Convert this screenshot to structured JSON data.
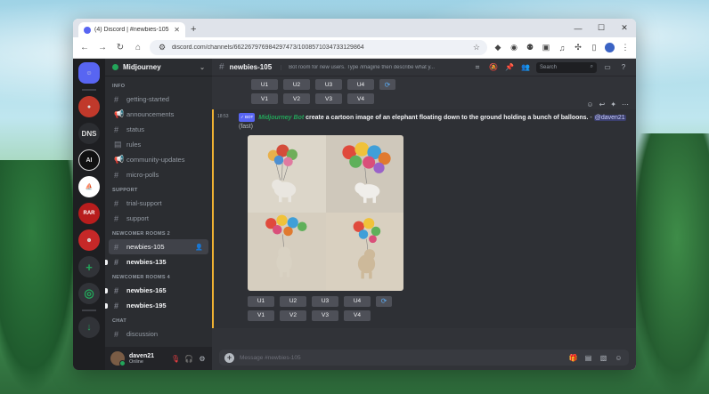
{
  "browser": {
    "tab_title": "(4) Discord | #newbies-105 | M",
    "url": "discord.com/channels/662267976984297473/1008571034733129864"
  },
  "guild": {
    "name": "Midjourney"
  },
  "servers": {
    "dns_label": "DNS",
    "ai_label": "AI",
    "rar_label": "RAR"
  },
  "channels": {
    "categories": {
      "info": "INFO",
      "support": "SUPPORT",
      "newcomer2": "NEWCOMER ROOMS 2",
      "newcomer4": "NEWCOMER ROOMS 4",
      "chat": "CHAT"
    },
    "items": {
      "getting_started": "getting-started",
      "announcements": "announcements",
      "status": "status",
      "rules": "rules",
      "community_updates": "community-updates",
      "micro_polls": "micro-polls",
      "trial_support": "trial-support",
      "support": "support",
      "newbies_105": "newbies-105",
      "newbies_135": "newbies-135",
      "newbies_165": "newbies-165",
      "newbies_195": "newbies-195",
      "discussion": "discussion"
    }
  },
  "user": {
    "name": "daven21",
    "status": "Online"
  },
  "header": {
    "channel": "newbies-105",
    "topic": "Bot room for new users. Type /imagine then describe what y...",
    "search_placeholder": "Search"
  },
  "buttons": {
    "u1": "U1",
    "u2": "U2",
    "u3": "U3",
    "u4": "U4",
    "v1": "V1",
    "v2": "V2",
    "v3": "V3",
    "v4": "V4"
  },
  "message": {
    "time": "18:53",
    "badge": "✓ BOT",
    "author": "Midjourney Bot",
    "prompt": "create a cartoon image of an elephant floating down to the ground holding a bunch of balloons.",
    "separator": " - ",
    "mention": "@daven21",
    "mode": "(fast)"
  },
  "composer": {
    "placeholder": "Message #newbies-105"
  }
}
